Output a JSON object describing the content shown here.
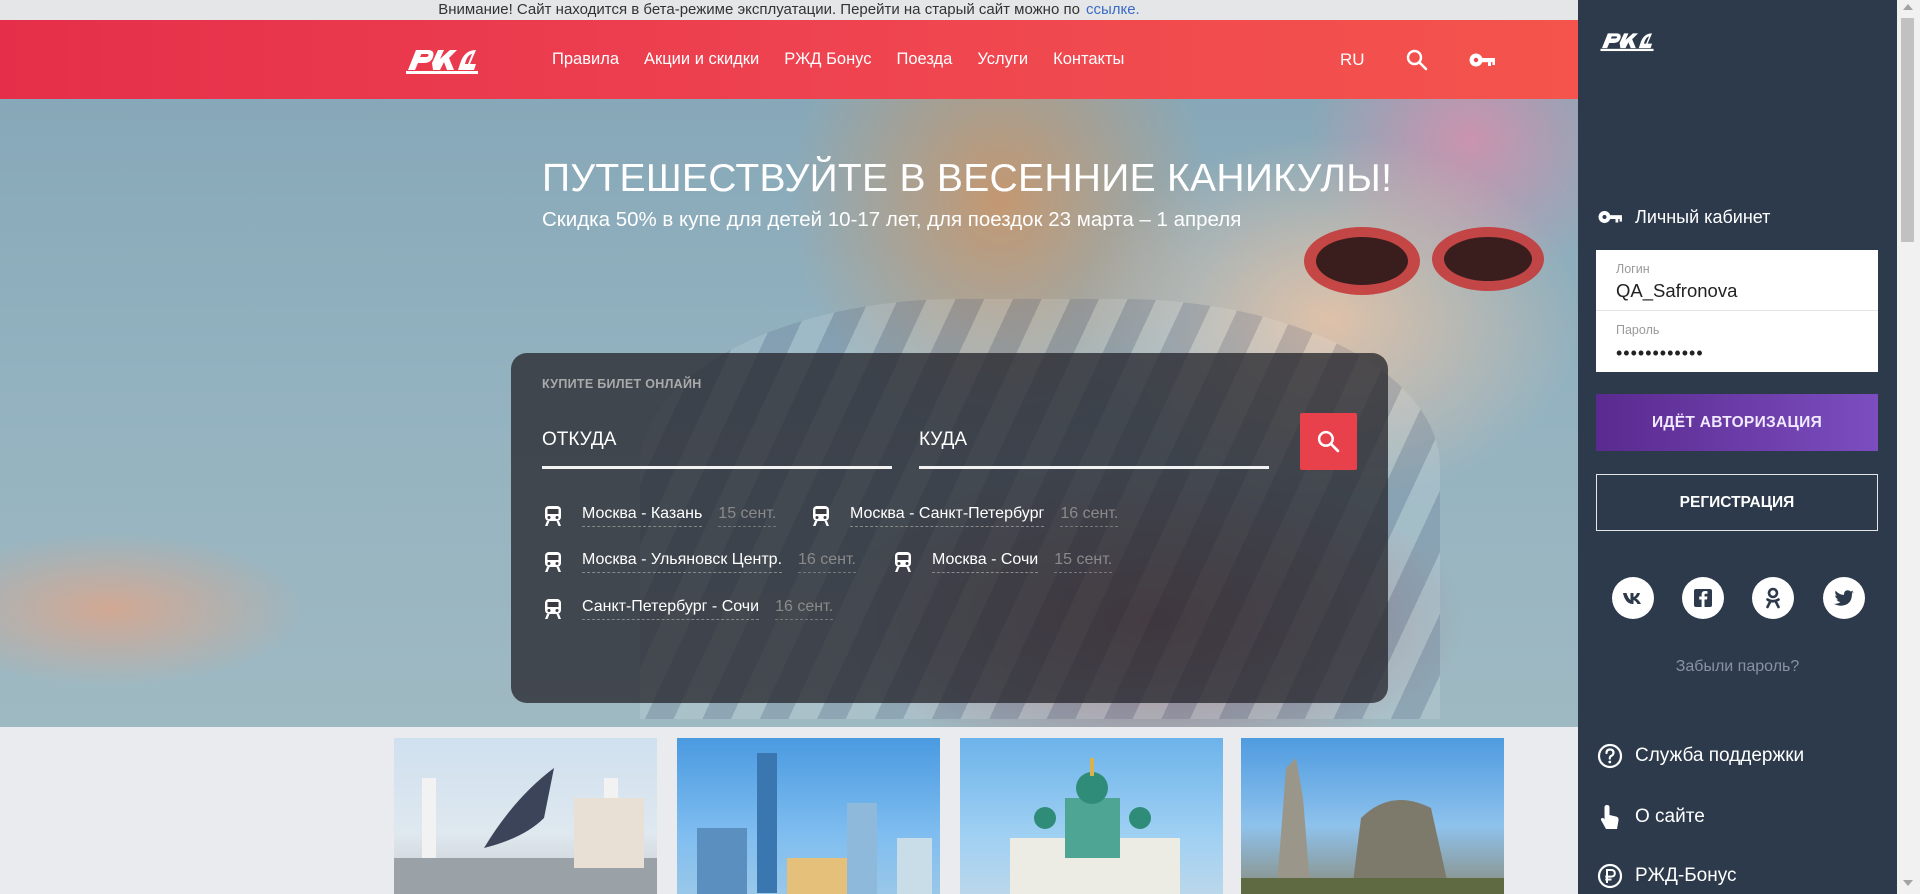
{
  "beta_banner": {
    "text": "Внимание! Сайт находится в бета-режиме эксплуатации. Перейти на старый сайт можно по",
    "link": "ссылке."
  },
  "header": {
    "logo": "РЖД",
    "nav": [
      "Правила",
      "Акции и скидки",
      "РЖД Бонус",
      "Поезда",
      "Услуги",
      "Контакты"
    ],
    "language": "RU",
    "icons": {
      "search": "search-icon",
      "key": "key-icon"
    }
  },
  "hero": {
    "title": "ПУТЕШЕСТВУЙТЕ В ВЕСЕННИЕ КАНИКУЛЫ!",
    "subtitle": "Скидка 50% в купе для детей 10-17 лет, для поездок 23 марта – 1 апреля"
  },
  "ticket_search": {
    "label": "КУПИТЕ БИЛЕТ ОНЛАЙН",
    "from_placeholder": "ОТКУДА",
    "to_placeholder": "КУДА",
    "routes": [
      {
        "name": "Москва - Казань",
        "date": "15 сент."
      },
      {
        "name": "Москва - Санкт-Петербург",
        "date": "16 сент."
      },
      {
        "name": "Москва - Ульяновск Центр.",
        "date": "16 сент."
      },
      {
        "name": "Москва - Сочи",
        "date": "15 сент."
      },
      {
        "name": "Санкт-Петербург - Сочи",
        "date": "16 сент."
      }
    ]
  },
  "panel": {
    "logo": "РЖД",
    "cabinet_label": "Личный кабинет",
    "login_label": "Логин",
    "login_value": "QA_Safronova",
    "password_label": "Пароль",
    "password_value": "••••••••••••",
    "auth_button": "ИДЁТ АВТОРИЗАЦИЯ",
    "register_button": "РЕГИСТРАЦИЯ",
    "socials": [
      "vk-icon",
      "facebook-icon",
      "odnoklassniki-icon",
      "twitter-icon"
    ],
    "forgot_password": "Забыли пароль?",
    "links": [
      {
        "label": "Служба поддержки",
        "icon": "help-circle-icon"
      },
      {
        "label": "О сайте",
        "icon": "pointer-hand-icon"
      },
      {
        "label": "РЖД-Бонус",
        "icon": "ruble-circle-icon"
      }
    ]
  },
  "colors": {
    "header_red": "#e8414b",
    "panel_bg": "#2c3a4b",
    "auth_purple": "#6a3aa8",
    "search_btn": "#e8414b"
  }
}
